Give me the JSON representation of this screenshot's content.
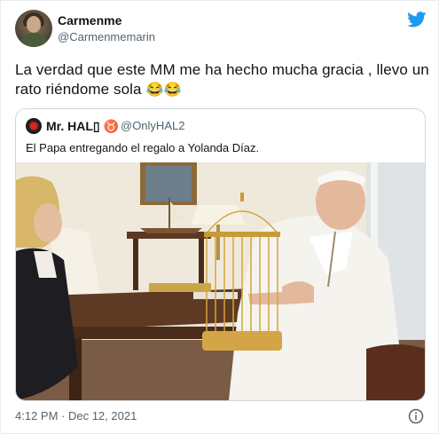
{
  "tweet": {
    "display_name": "Carmenme",
    "handle": "@Carmenmemarin",
    "text": "La verdad que este MM me ha hecho mucha gracia , llevo un rato riéndome sola",
    "emojis": "😂😂",
    "timestamp": "4:12 PM · Dec 12, 2021"
  },
  "quoted_tweet": {
    "display_name": "Mr. HAL▯ ♉",
    "handle": "@OnlyHAL2",
    "text": "El Papa entregando el regalo a Yolanda Díaz."
  },
  "icons": {
    "brand": "twitter-bird-icon",
    "info": "info-icon"
  },
  "colors": {
    "brand_blue": "#1d9bf0",
    "secondary_text": "#536471",
    "border": "#cfd9de"
  }
}
